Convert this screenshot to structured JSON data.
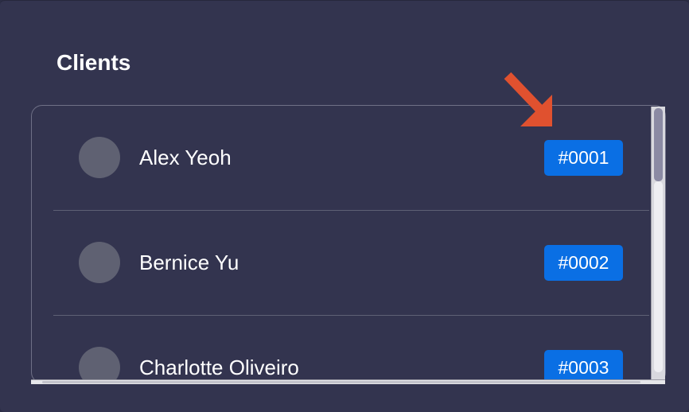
{
  "section": {
    "title": "Clients"
  },
  "clients": [
    {
      "name": "Alex Yeoh",
      "id": "#0001"
    },
    {
      "name": "Bernice Yu",
      "id": "#0002"
    },
    {
      "name": "Charlotte Oliveiro",
      "id": "#0003"
    }
  ],
  "annotation": {
    "arrow_color": "#e0512f",
    "points_to": "#0001"
  },
  "colors": {
    "badge": "#0a6fe4",
    "panel": "#33344f",
    "avatar": "#5f6172"
  }
}
